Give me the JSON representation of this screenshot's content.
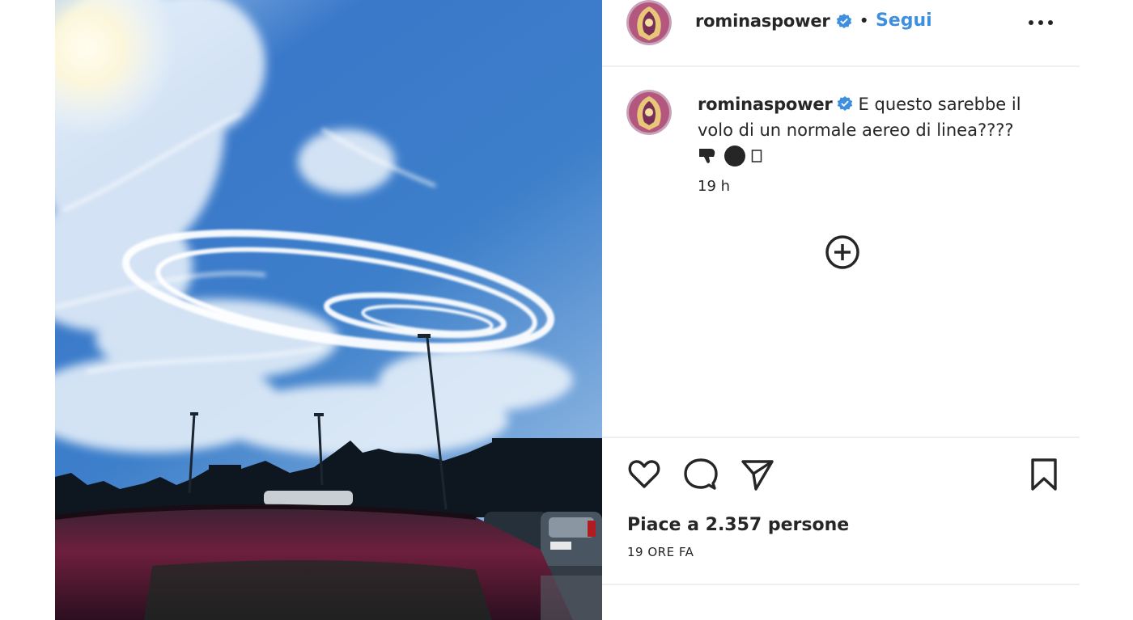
{
  "post": {
    "username": "rominaspower",
    "follow_label": "Segui",
    "separator": "•",
    "caption": {
      "text": "E questo sarebbe il volo di un normale aereo di linea????",
      "time": "19 h"
    },
    "likes_text": "Piace a 2.357 persone",
    "posted_time": "19 ORE FA",
    "comment_peek": "... ... ... ... ... ... ..."
  },
  "icons": {
    "verified": "verified-badge-icon",
    "more": "more-options-icon",
    "load_more": "add-circle-icon",
    "like": "heart-icon",
    "comment": "comment-bubble-icon",
    "share": "paper-plane-icon",
    "save": "bookmark-icon"
  },
  "colors": {
    "accent": "#3f8fe0",
    "text": "#262626",
    "sky": "#3f7cc8"
  }
}
